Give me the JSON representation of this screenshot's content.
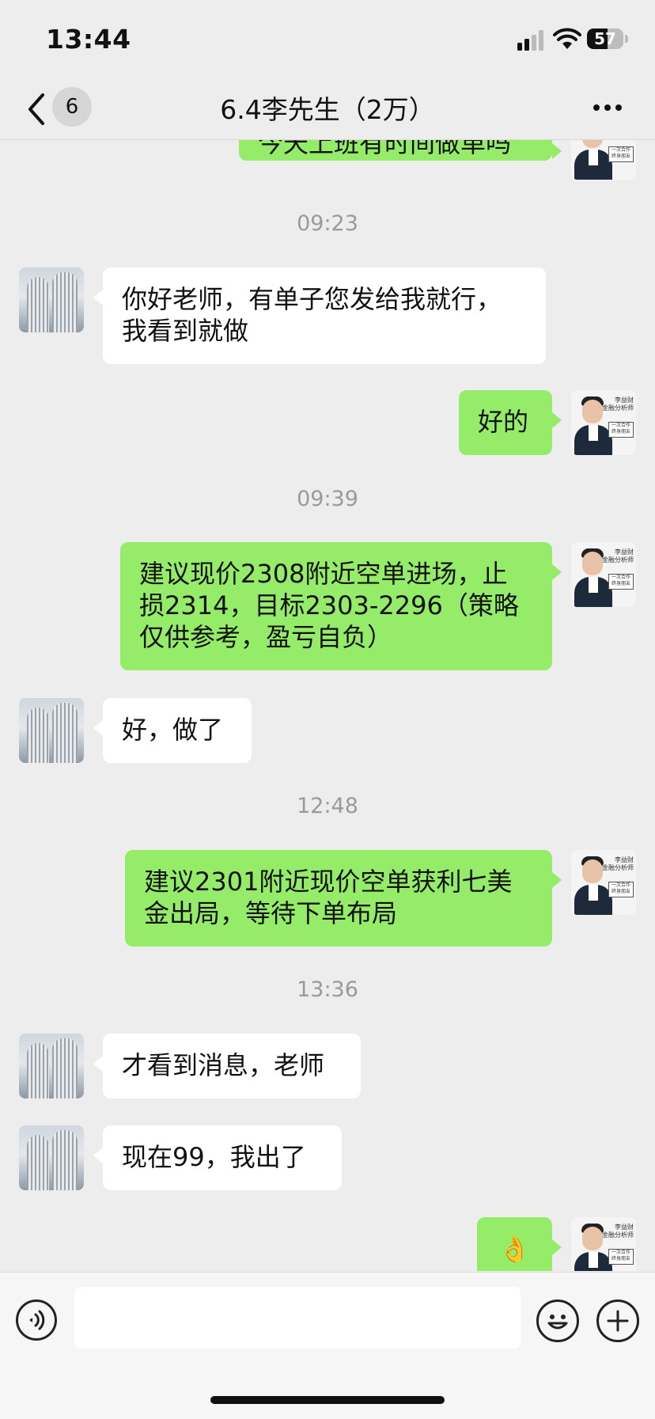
{
  "status_bar": {
    "time": "13:44",
    "battery_percent": 57,
    "battery_label": "57"
  },
  "header": {
    "back_icon": "chevron-left-icon",
    "unread_count": "6",
    "title": "6.4李先生（2万）",
    "more_icon": "more-dots-icon"
  },
  "messages": [
    {
      "type": "out",
      "text": "今天上班有时间做单吗"
    },
    {
      "type": "time",
      "text": "09:23"
    },
    {
      "type": "in",
      "text": "你好老师，有单子您发给我就行，\n我看到就做"
    },
    {
      "type": "out",
      "text": "好的"
    },
    {
      "type": "time",
      "text": "09:39"
    },
    {
      "type": "out",
      "text": "建议现价2308附近空单进场，止\n损2314，目标2303-2296（策略\n仅供参考，盈亏自负）"
    },
    {
      "type": "in",
      "text": "好，做了"
    },
    {
      "type": "time",
      "text": "12:48"
    },
    {
      "type": "out",
      "text": "建议2301附近现价空单获利七美\n金出局，等待下单布局"
    },
    {
      "type": "time",
      "text": "13:36"
    },
    {
      "type": "in",
      "text": "才看到消息，老师"
    },
    {
      "type": "in",
      "text": "现在99，我出了"
    },
    {
      "type": "out",
      "text": "👌"
    }
  ],
  "teacher_avatar": {
    "name_tag": "李益财",
    "title_tag": "金融分析师",
    "box_text": "一次合作 终身朋友"
  },
  "input_bar": {
    "voice_icon": "voice-icon",
    "input_value": "",
    "emoji_icon": "emoji-icon",
    "plus_icon": "plus-circle-icon"
  },
  "colors": {
    "background": "#ededed",
    "outgoing_bubble": "#95ec69",
    "incoming_bubble": "#ffffff",
    "timestamp": "#9a9a9a"
  }
}
